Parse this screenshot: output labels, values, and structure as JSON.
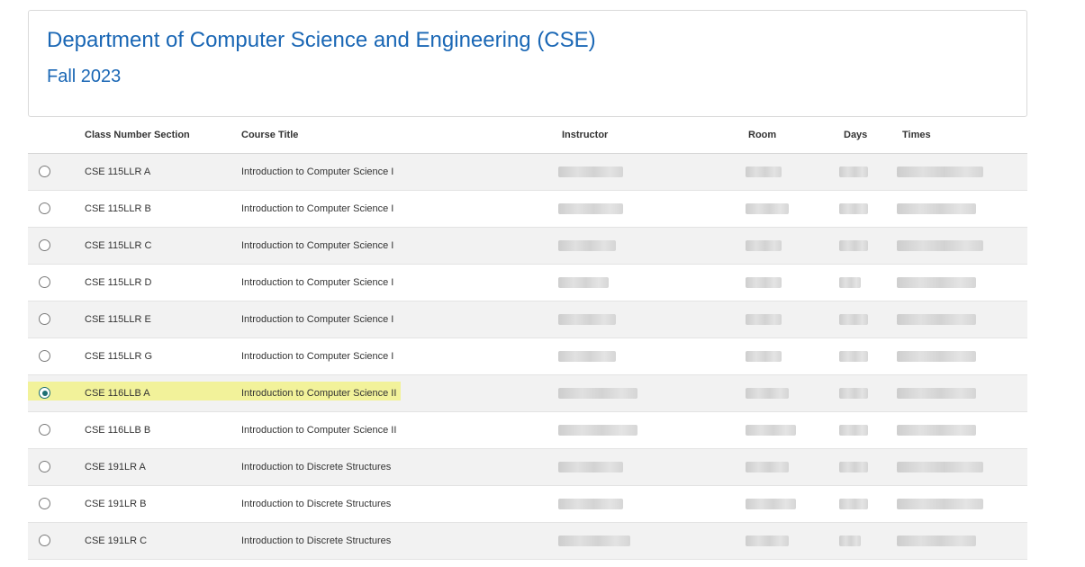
{
  "header": {
    "department": "Department of Computer Science and Engineering (CSE)",
    "term": "Fall 2023"
  },
  "table": {
    "columns": [
      "Class Number Section",
      "Course Title",
      "Instructor",
      "Room",
      "Days",
      "Times"
    ],
    "rows": [
      {
        "section": "CSE 115LLR A",
        "title": "Introduction to Computer Science I",
        "selected": false
      },
      {
        "section": "CSE 115LLR B",
        "title": "Introduction to Computer Science I",
        "selected": false
      },
      {
        "section": "CSE 115LLR C",
        "title": "Introduction to Computer Science I",
        "selected": false
      },
      {
        "section": "CSE 115LLR D",
        "title": "Introduction to Computer Science I",
        "selected": false
      },
      {
        "section": "CSE 115LLR E",
        "title": "Introduction to Computer Science I",
        "selected": false
      },
      {
        "section": "CSE 115LLR G",
        "title": "Introduction to Computer Science I",
        "selected": false
      },
      {
        "section": "CSE 116LLB A",
        "title": "Introduction to Computer Science II",
        "selected": true
      },
      {
        "section": "CSE 116LLB B",
        "title": "Introduction to Computer Science II",
        "selected": false
      },
      {
        "section": "CSE 191LR A",
        "title": "Introduction to Discrete Structures",
        "selected": false
      },
      {
        "section": "CSE 191LR B",
        "title": "Introduction to Discrete Structures",
        "selected": false
      },
      {
        "section": "CSE 191LR C",
        "title": "Introduction to Discrete Structures",
        "selected": false
      }
    ]
  },
  "colors": {
    "heading": "#1a67b5",
    "highlight": "#f2f29a",
    "radio_selected": "#1e6f73",
    "row_alt": "#f2f2f2"
  }
}
